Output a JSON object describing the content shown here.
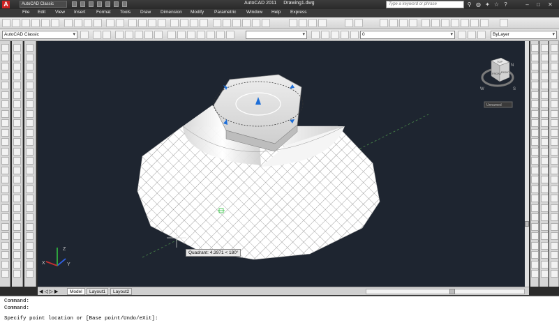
{
  "titlebar": {
    "app_icon_letter": "A",
    "workspace": "AutoCAD Classic",
    "app_name": "AutoCAD 2011",
    "document": "Drawing1.dwg",
    "search_placeholder": "Type a keyword or phrase"
  },
  "menu": [
    "File",
    "Edit",
    "View",
    "Insert",
    "Format",
    "Tools",
    "Draw",
    "Dimension",
    "Modify",
    "Parametric",
    "Window",
    "Help",
    "Express"
  ],
  "toolbar2": {
    "workspace": "AutoCAD Classic",
    "layer_value": "0",
    "linetype": "ByLayer"
  },
  "viewcube": {
    "top": "TOP",
    "front": "FRONT",
    "right": "RIGHT",
    "compass_n": "N",
    "compass_w": "W",
    "compass_s": "S",
    "wcs": "Unnamed"
  },
  "tooltip": "Quadrant: 4.3971 < 180°",
  "tabs": [
    "Model",
    "Layout1",
    "Layout2"
  ],
  "command": {
    "line1": "Command:",
    "line2": "Command:",
    "line3": "Specify point location or [Base point/Undo/eXit]:"
  },
  "colors": {
    "viewport_bg": "#1e2530",
    "grip_blue": "#1e6fd8",
    "ucs_x": "#c83030",
    "ucs_y": "#30b040",
    "ucs_z": "#3060e0"
  }
}
